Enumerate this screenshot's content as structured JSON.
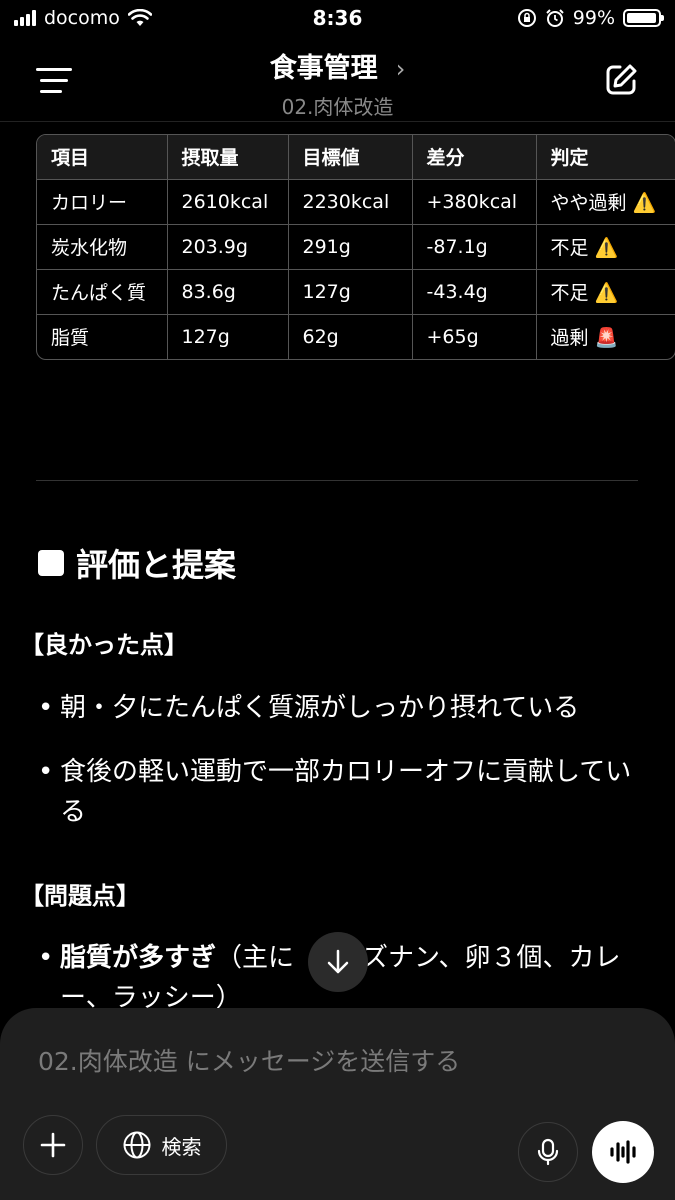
{
  "status_bar": {
    "carrier": "docomo",
    "time": "8:36",
    "battery": "99%",
    "battery_level": 0.99
  },
  "header": {
    "title": "食事管理",
    "title_chevron": "›",
    "subtitle": "02.肉体改造"
  },
  "table": {
    "headers": [
      "項目",
      "摂取量",
      "目標値",
      "差分",
      "判定"
    ],
    "rows": [
      [
        "カロリー",
        "2610kcal",
        "2230kcal",
        "+380kcal",
        "やや過剰 ⚠️"
      ],
      [
        "炭水化物",
        "203.9g",
        "291g",
        "-87.1g",
        "不足 ⚠️"
      ],
      [
        "たんぱく質",
        "83.6g",
        "127g",
        "-43.4g",
        "不足 ⚠️"
      ],
      [
        "脂質",
        "127g",
        "62g",
        "+65g",
        "過剰 🚨"
      ]
    ]
  },
  "content": {
    "section_title": "評価と提案",
    "good_heading": "【良かった点】",
    "good_items": [
      "朝・夕にたんぱく質源がしっかり摂れている",
      "食後の軽い運動で一部カロリーオフに貢献している"
    ],
    "problem_heading": "【問題点】",
    "problem_item_bold": "脂質が多すぎ",
    "problem_item_rest": "（主に",
    "problem_item_rest2": "ズナン、卵３個、カレー、ラッシー）"
  },
  "composer": {
    "placeholder": "02.肉体改造 にメッセージを送信する",
    "search_label": "検索"
  }
}
